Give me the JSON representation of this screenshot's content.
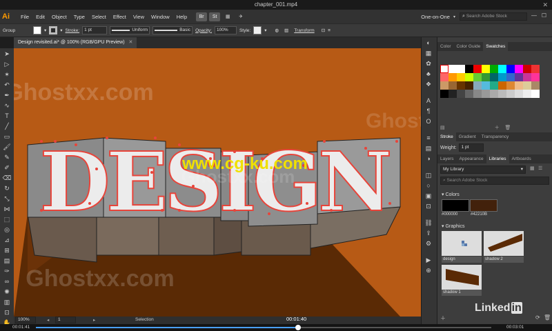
{
  "window": {
    "title": "chapter_001.mp4"
  },
  "menu": {
    "logo": "Ai",
    "items": [
      "File",
      "Edit",
      "Object",
      "Type",
      "Select",
      "Effect",
      "View",
      "Window",
      "Help"
    ],
    "br": "Br",
    "st": "St",
    "workspace": "One-on-One",
    "search_placeholder": "Search Adobe Stock"
  },
  "control": {
    "group": "Group",
    "stroke_label": "Stroke:",
    "stroke_value": "1 pt",
    "profile": "Uniform",
    "brush": "Basic",
    "opacity_label": "Opacity:",
    "opacity_value": "100%",
    "style_label": "Style:",
    "transform": "Transform"
  },
  "doc": {
    "tab_label": "Design revisited.ai* @ 100% (RGB/GPU Preview)"
  },
  "canvas": {
    "word": "DESIGN",
    "watermark_site": "www.cg-ku.com",
    "watermark_ghost": "Ghostxx.com",
    "watermark_ghost2": "Ghostxx.com",
    "watermark_ghost3": "Ghostxx.com",
    "watermark_ghost4": "Ghostxx.com",
    "watermark_ghost5": "Ghostxx.com",
    "watermark_ghost6": "Ghostxx.com"
  },
  "status": {
    "zoom": "100%",
    "artboard": "1",
    "mode": "Selection"
  },
  "panel": {
    "top_tabs": [
      "Color",
      "Color Guide",
      "Swatches"
    ],
    "stroke_tabs": [
      "Stroke",
      "Gradient",
      "Transparency"
    ],
    "weight_label": "Weight:",
    "weight_value": "1 pt",
    "lib_tabs": [
      "Layers",
      "Appearance",
      "Libraries",
      "Artboards"
    ],
    "library": "My Library",
    "lib_search": "Search Adobe Stock",
    "colors_header": "Colors",
    "color1": "#000000",
    "color2": "#42210B",
    "graphics_header": "Graphics",
    "graphics": [
      "design",
      "shadow 2",
      "shadow 1"
    ]
  },
  "video": {
    "elapsed": "00:01:41",
    "pointer": "00:01:40",
    "total": "00:03:01"
  },
  "branding": {
    "linkedin": "Linked",
    "linkedin_in": "in"
  },
  "colors": {
    "canvas": "#b75a15",
    "accent": "#f0c000",
    "selection": "#e8443a"
  }
}
